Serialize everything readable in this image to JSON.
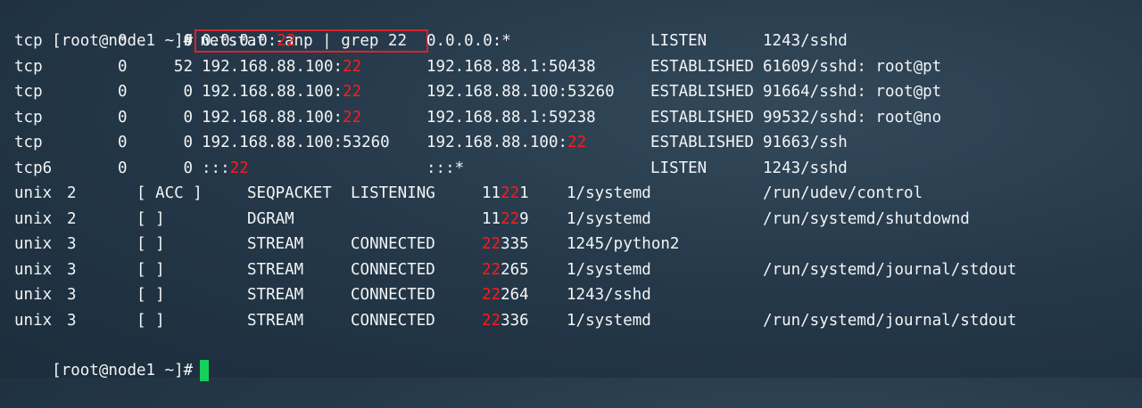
{
  "prompt": "[root@node1 ~]#",
  "command": "netstat -anp | grep 22",
  "colors": {
    "highlight": "#ff1a1a",
    "cursor": "#15d15a",
    "command_box": "#d9232d"
  },
  "tcp_rows": [
    {
      "proto": "tcp",
      "recv": "0",
      "send": "0",
      "local": [
        "0.0.0.0:",
        "22",
        ""
      ],
      "foreign": [
        "0.0.0.0:*",
        "",
        ""
      ],
      "state": "LISTEN",
      "pid": "1243/sshd"
    },
    {
      "proto": "tcp",
      "recv": "0",
      "send": "52",
      "local": [
        "192.168.88.100:",
        "22",
        ""
      ],
      "foreign": [
        "192.168.88.1:50438",
        "",
        ""
      ],
      "state": "ESTABLISHED",
      "pid": "61609/sshd: root@pt"
    },
    {
      "proto": "tcp",
      "recv": "0",
      "send": "0",
      "local": [
        "192.168.88.100:",
        "22",
        ""
      ],
      "foreign": [
        "192.168.88.100:53260",
        "",
        ""
      ],
      "state": "ESTABLISHED",
      "pid": "91664/sshd: root@pt"
    },
    {
      "proto": "tcp",
      "recv": "0",
      "send": "0",
      "local": [
        "192.168.88.100:",
        "22",
        ""
      ],
      "foreign": [
        "192.168.88.1:59238",
        "",
        ""
      ],
      "state": "ESTABLISHED",
      "pid": "99532/sshd: root@no"
    },
    {
      "proto": "tcp",
      "recv": "0",
      "send": "0",
      "local": [
        "192.168.88.100:53260",
        "",
        ""
      ],
      "foreign": [
        "192.168.88.100:",
        "22",
        ""
      ],
      "state": "ESTABLISHED",
      "pid": "91663/ssh"
    },
    {
      "proto": "tcp6",
      "recv": "0",
      "send": "0",
      "local": [
        ":::",
        "22",
        ""
      ],
      "foreign": [
        ":::*",
        "",
        ""
      ],
      "state": "LISTEN",
      "pid": "1243/sshd"
    }
  ],
  "unix_rows": [
    {
      "proto": "unix",
      "refcnt": "2",
      "flags": "[ ACC ]",
      "type": "SEQPACKET",
      "state": "LISTENING",
      "inode": [
        "11",
        "22",
        "1"
      ],
      "pid": "1/systemd",
      "path": "/run/udev/control"
    },
    {
      "proto": "unix",
      "refcnt": "2",
      "flags": "[ ]",
      "type": "DGRAM",
      "state": "",
      "inode": [
        "11",
        "22",
        "9"
      ],
      "pid": "1/systemd",
      "path": "/run/systemd/shutdownd"
    },
    {
      "proto": "unix",
      "refcnt": "3",
      "flags": "[ ]",
      "type": "STREAM",
      "state": "CONNECTED",
      "inode": [
        "",
        "22",
        "335"
      ],
      "pid": "1245/python2",
      "path": ""
    },
    {
      "proto": "unix",
      "refcnt": "3",
      "flags": "[ ]",
      "type": "STREAM",
      "state": "CONNECTED",
      "inode": [
        "",
        "22",
        "265"
      ],
      "pid": "1/systemd",
      "path": "/run/systemd/journal/stdout"
    },
    {
      "proto": "unix",
      "refcnt": "3",
      "flags": "[ ]",
      "type": "STREAM",
      "state": "CONNECTED",
      "inode": [
        "",
        "22",
        "264"
      ],
      "pid": "1243/sshd",
      "path": ""
    },
    {
      "proto": "unix",
      "refcnt": "3",
      "flags": "[ ]",
      "type": "STREAM",
      "state": "CONNECTED",
      "inode": [
        "",
        "22",
        "336"
      ],
      "pid": "1/systemd",
      "path": "/run/systemd/journal/stdout"
    }
  ]
}
